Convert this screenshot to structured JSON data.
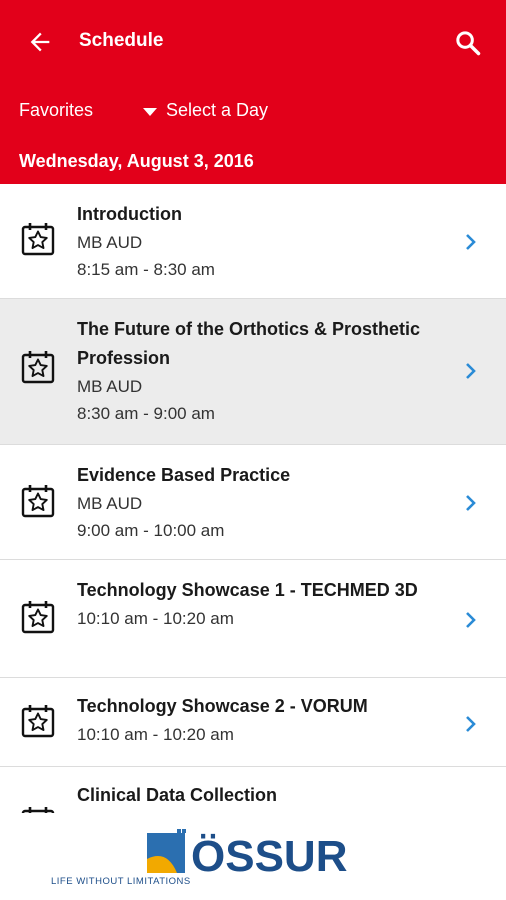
{
  "header": {
    "title": "Schedule",
    "favorites_label": "Favorites",
    "day_select_label": "Select a Day",
    "date": "Wednesday, August 3, 2016",
    "accent_color": "#e2001a"
  },
  "sessions": [
    {
      "title": "Introduction",
      "location": "MB AUD",
      "time": "8:15 am - 8:30 am"
    },
    {
      "title": "The Future of the Orthotics & Prosthetic Profession",
      "location": "MB AUD",
      "time": "8:30 am - 9:00 am"
    },
    {
      "title": "Evidence Based Practice",
      "location": "MB AUD",
      "time": "9:00 am - 10:00 am"
    },
    {
      "title": "Technology Showcase 1 - TECHMED 3D",
      "time": "10:10 am - 10:20 am"
    },
    {
      "title": "Technology Showcase 2 - VORUM",
      "time": "10:10 am - 10:20 am"
    },
    {
      "title": "Clinical Data Collection"
    }
  ],
  "footer": {
    "logo_text": "ÖSSUR",
    "tagline": "LIFE WITHOUT LIMITATIONS"
  },
  "icons": {
    "back": "arrow-left-icon",
    "search": "search-icon",
    "calendar": "calendar-star-icon",
    "chevron": "chevron-right-icon"
  }
}
